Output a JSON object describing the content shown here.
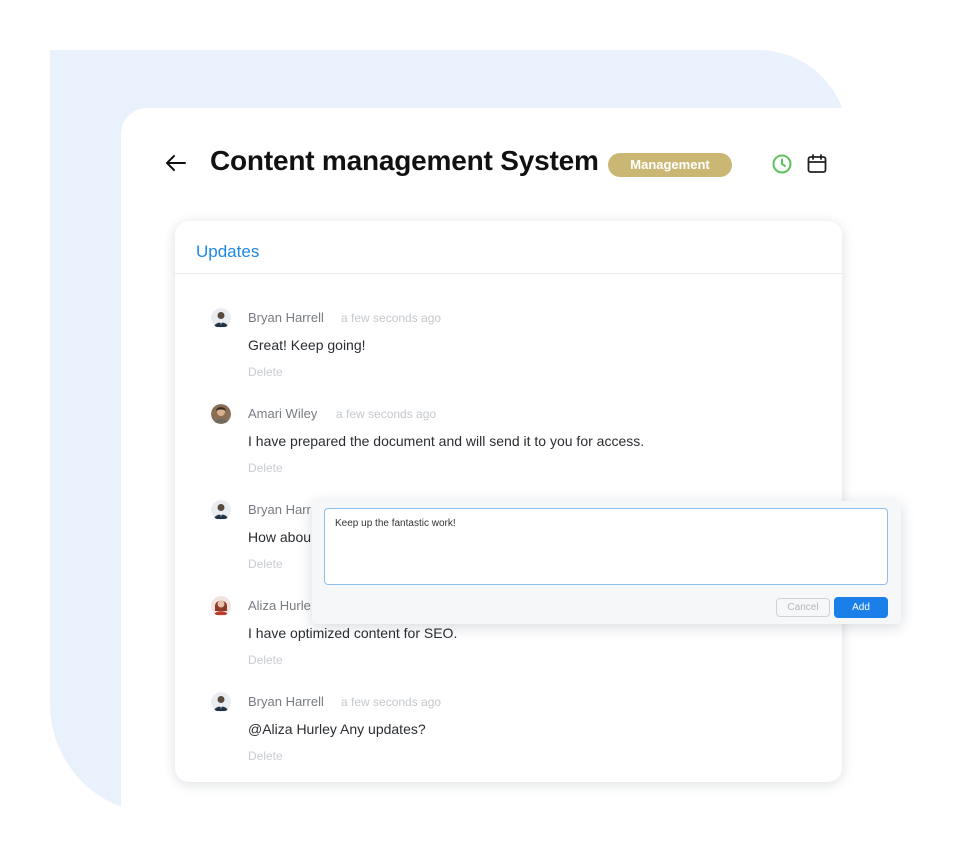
{
  "header": {
    "title": "Content management System",
    "tag": "Management",
    "back_icon": "arrow-left-icon",
    "clock_icon": "clock-icon",
    "calendar_icon": "calendar-icon",
    "tag_color": "#cbb774",
    "clock_color": "#5fc35d"
  },
  "updates": {
    "title": "Updates",
    "title_color": "#1e88e5",
    "comments": [
      {
        "author": "Bryan Harrell",
        "time": "a few seconds ago",
        "text": "Great! Keep going!",
        "delete": "Delete"
      },
      {
        "author": "Amari Wiley",
        "time": "a few seconds ago",
        "text": "I have prepared the document and will send it to you for access.",
        "delete": "Delete"
      },
      {
        "author": "Bryan Harr",
        "time": "",
        "text": "How abou",
        "delete": "Delete"
      },
      {
        "author": "Aliza Hurle",
        "time": "",
        "text": "I have optimized content for SEO.",
        "delete": "Delete"
      },
      {
        "author": "Bryan Harrell",
        "time": "a few seconds ago",
        "text": "@Aliza Hurley Any updates?",
        "delete": "Delete"
      }
    ]
  },
  "reply": {
    "value": "Keep up the fantastic work!",
    "cancel_label": "Cancel",
    "add_label": "Add",
    "accent": "#1a7fe8"
  }
}
